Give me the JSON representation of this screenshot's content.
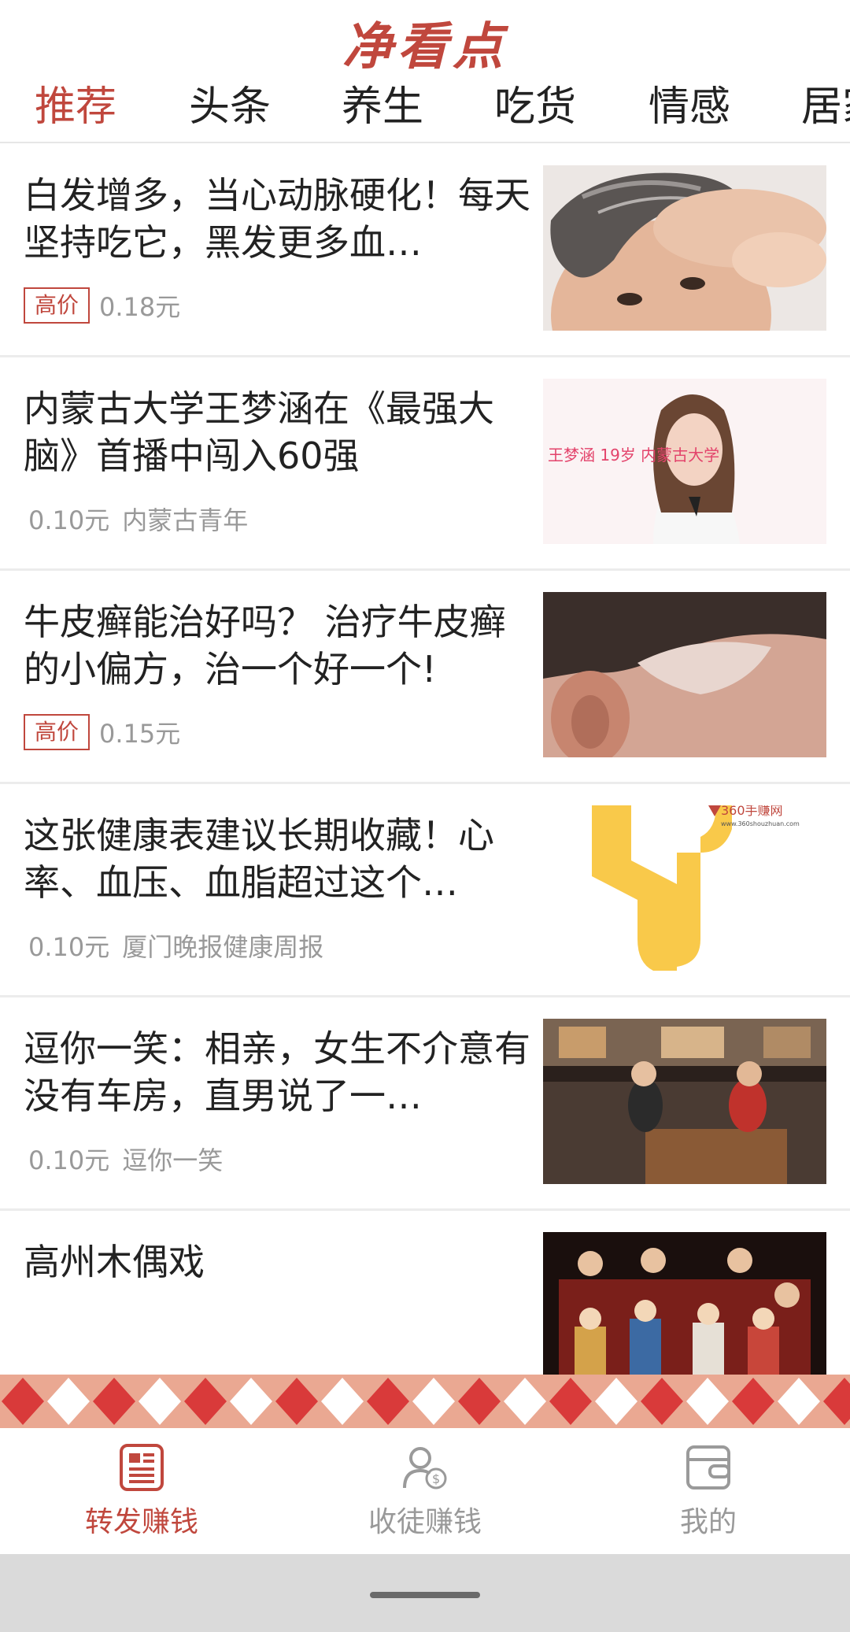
{
  "app": {
    "title": "净看点"
  },
  "tabs": [
    {
      "label": "推荐",
      "active": true
    },
    {
      "label": "头条",
      "active": false
    },
    {
      "label": "养生",
      "active": false
    },
    {
      "label": "吃货",
      "active": false
    },
    {
      "label": "情感",
      "active": false
    },
    {
      "label": "居家",
      "active": false
    }
  ],
  "feed": [
    {
      "title": "白发增多，当心动脉硬化！每天坚持吃它，黑发更多血…",
      "badge": "高价",
      "price": "0.18元",
      "source": "",
      "thumb_icon": "man-gray-hair-photo"
    },
    {
      "title": "内蒙古大学王梦涵在《最强大脑》首播中闯入60强",
      "badge": "",
      "price": "0.10元",
      "source": "内蒙古青年",
      "thumb_icon": "woman-portrait-photo",
      "thumb_caption": "王梦涵 19岁 内蒙古大学"
    },
    {
      "title": "牛皮癣能治好吗？ 治疗牛皮癣的小偏方，治一个好一个!",
      "badge": "高价",
      "price": "0.15元",
      "source": "",
      "thumb_icon": "scalp-psoriasis-photo"
    },
    {
      "title": "这张健康表建议长期收藏！心率、血压、血脂超过这个…",
      "badge": "",
      "price": "0.10元",
      "source": "厦门晚报健康周报",
      "thumb_icon": "yellow-graphic",
      "watermark": "360手赚网",
      "watermark_url": "www.360shouzhuan.com"
    },
    {
      "title": "逗你一笑：相亲，女生不介意有没有车房，直男说了一…",
      "badge": "",
      "price": "0.10元",
      "source": "逗你一笑",
      "thumb_icon": "restaurant-couple-photo"
    },
    {
      "title": "高州木偶戏",
      "badge": "",
      "price": "",
      "source": "",
      "thumb_icon": "puppet-show-photo"
    }
  ],
  "bottom_nav": [
    {
      "label": "转发赚钱",
      "icon": "article-icon",
      "active": true
    },
    {
      "label": "收徒赚钱",
      "icon": "user-coin-icon",
      "active": false
    },
    {
      "label": "我的",
      "icon": "wallet-icon",
      "active": false
    }
  ],
  "colors": {
    "accent": "#c0473d",
    "muted": "#999999",
    "band": "#e9a48f"
  }
}
